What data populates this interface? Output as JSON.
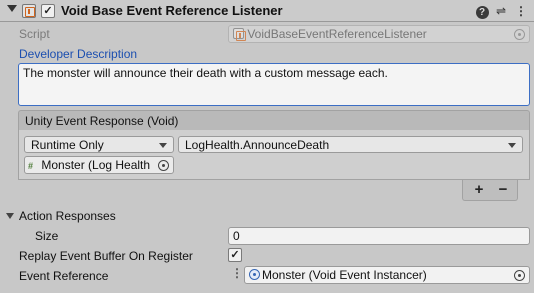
{
  "header": {
    "title": "Void Base Event Reference Listener",
    "enabled_mark": "✓",
    "help_glyph": "?",
    "preset_glyph": "⇌",
    "menu_glyph": "⋮"
  },
  "script_field": {
    "label": "Script",
    "value": "VoidBaseEventReferenceListener"
  },
  "developer_description": {
    "label": "Developer Description",
    "text": "The monster will announce their death with a custom message each."
  },
  "unity_event": {
    "header": "Unity Event Response (Void)",
    "call_state": "Runtime Only",
    "function": "LogHealth.AnnounceDeath",
    "target_object": "Monster (Log Health",
    "add_glyph": "+",
    "remove_glyph": "−"
  },
  "action_responses": {
    "label": "Action Responses",
    "size_label": "Size",
    "size_value": "0"
  },
  "replay_buffer": {
    "label": "Replay Event Buffer On Register",
    "checked_mark": "✓"
  },
  "event_reference": {
    "label": "Event Reference",
    "value": "Monster (Void Event Instancer)"
  }
}
